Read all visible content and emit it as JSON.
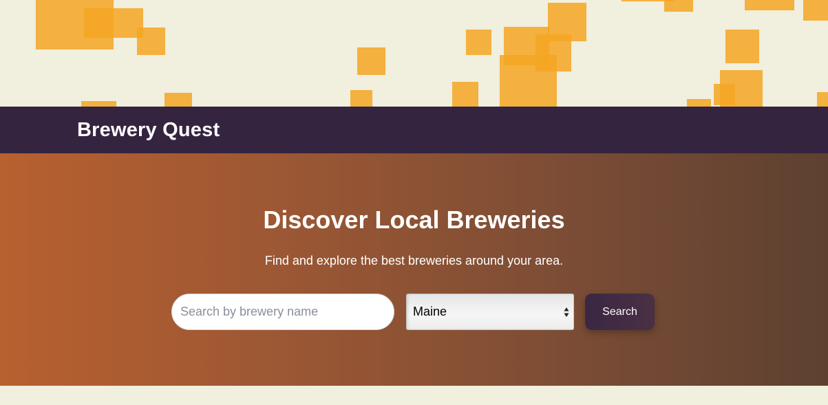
{
  "header": {
    "brand": "Brewery Quest"
  },
  "hero": {
    "title": "Discover Local Breweries",
    "subtitle": "Find and explore the best breweries around your area."
  },
  "search": {
    "placeholder": "Search by brewery name",
    "value": "",
    "state_selected": "Maine",
    "button_label": "Search"
  },
  "colors": {
    "background": "#f1efdd",
    "decor_squares": "#f5a623",
    "header_bg": "#352440",
    "hero_gradient_start": "#b8602f",
    "hero_gradient_end": "#5d4130",
    "button_bg": "#3a2743"
  }
}
